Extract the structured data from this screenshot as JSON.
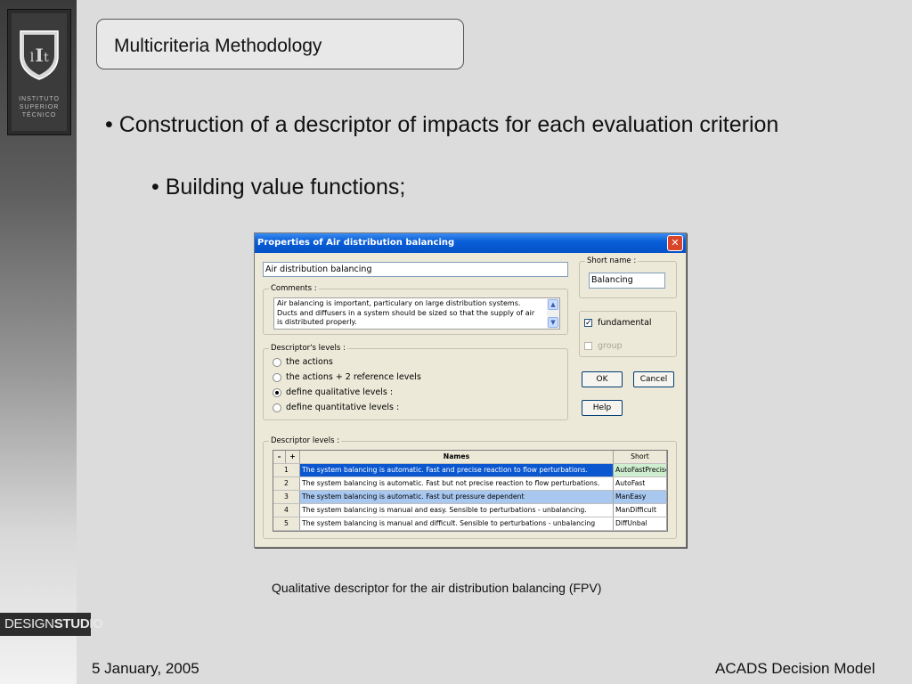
{
  "slide": {
    "title": "Multicriteria Methodology",
    "bullet1": "• Construction of a descriptor of impacts for each evaluation criterion",
    "bullet2": "• Building value functions;",
    "caption": "Qualitative descriptor for the air distribution balancing (FPV)",
    "footer_date": "5 January, 2005",
    "footer_model": "ACADS Decision Model"
  },
  "logo": {
    "text": "INSTITUTO\nSUPERIOR\nTÉCNICO",
    "badge_design": "DESIGN",
    "badge_studio": "STUDIO"
  },
  "dialog": {
    "title": "Properties of  Air distribution balancing",
    "name_value": "Air distribution balancing",
    "short_name_legend": "Short name :",
    "short_name_value": "Balancing",
    "comments_legend": "Comments :",
    "comments_text": "Air balancing is important, particulary on large distribution systems. Ducts and diffusers in a system should be sized so that the supply of air is distributed properly.",
    "fundamental_label": "fundamental",
    "fundamental_checked": true,
    "group_label": "group",
    "descriptor_legend": "Descriptor's levels :",
    "radio_options": [
      "the actions",
      "the actions + 2 reference levels",
      "define qualitative levels :",
      "define quantitative levels :"
    ],
    "selected_option": 2,
    "ok_label": "OK",
    "cancel_label": "Cancel",
    "help_label": "Help",
    "levels_legend": "Descriptor levels :",
    "grid": {
      "minus": "–",
      "plus": "+",
      "col_names": "Names",
      "col_short": "Short",
      "rows": [
        {
          "num": "1",
          "name": "The system balancing is automatic. Fast and precise reaction to flow perturbations.",
          "short": "AutoFastPrecise"
        },
        {
          "num": "2",
          "name": "The system balancing is automatic. Fast but not precise reaction to flow perturbations.",
          "short": "AutoFast"
        },
        {
          "num": "3",
          "name": "The system balancing is automatic. Fast but pressure dependent",
          "short": "ManEasy"
        },
        {
          "num": "4",
          "name": "The system balancing is manual and easy. Sensible to perturbations - unbalancing.",
          "short": "ManDifficult"
        },
        {
          "num": "5",
          "name": "The system balancing is manual and difficult. Sensible to perturbations - unbalancing",
          "short": "DiffUnbal"
        }
      ]
    }
  },
  "colors": {
    "titlebar": "#0451c8",
    "selection": "#0b57d0",
    "row_highlight": "#a8c8f0"
  }
}
